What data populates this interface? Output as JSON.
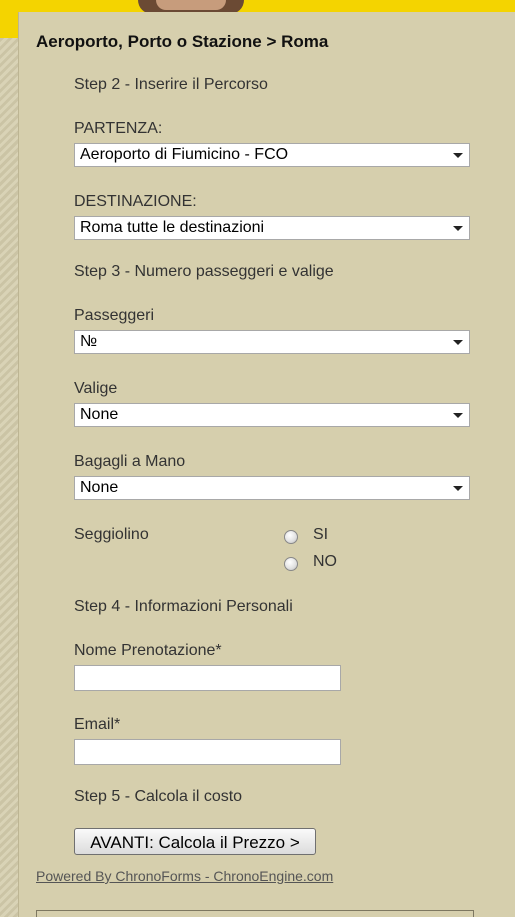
{
  "form": {
    "title": "Aeroporto, Porto o Stazione > Roma",
    "step2": "Step 2 - Inserire il Percorso",
    "partenza_label": "PARTENZA:",
    "partenza_value": "Aeroporto di Fiumicino - FCO",
    "destinazione_label": "DESTINAZIONE:",
    "destinazione_value": "Roma tutte le destinazioni",
    "step3": "Step 3 - Numero passeggeri e valige",
    "passeggeri_label": "Passeggeri",
    "passeggeri_value": "№",
    "valige_label": "Valige",
    "valige_value": "None",
    "bagagli_label": "Bagagli a Mano",
    "bagagli_value": "None",
    "seggiolino_label": "Seggiolino",
    "radio_si": "SI",
    "radio_no": "NO",
    "step4": "Step 4 - Informazioni Personali",
    "nome_label": "Nome Prenotazione*",
    "email_label": "Email*",
    "step5": "Step 5 - Calcola il costo",
    "submit_label": "AVANTI: Calcola il Prezzo >",
    "powered": "Powered By ChronoForms - ChronoEngine.com"
  },
  "colors": {
    "banner": "#f4d400",
    "panel": "#d6cfad",
    "background": "#cfc9ac"
  }
}
